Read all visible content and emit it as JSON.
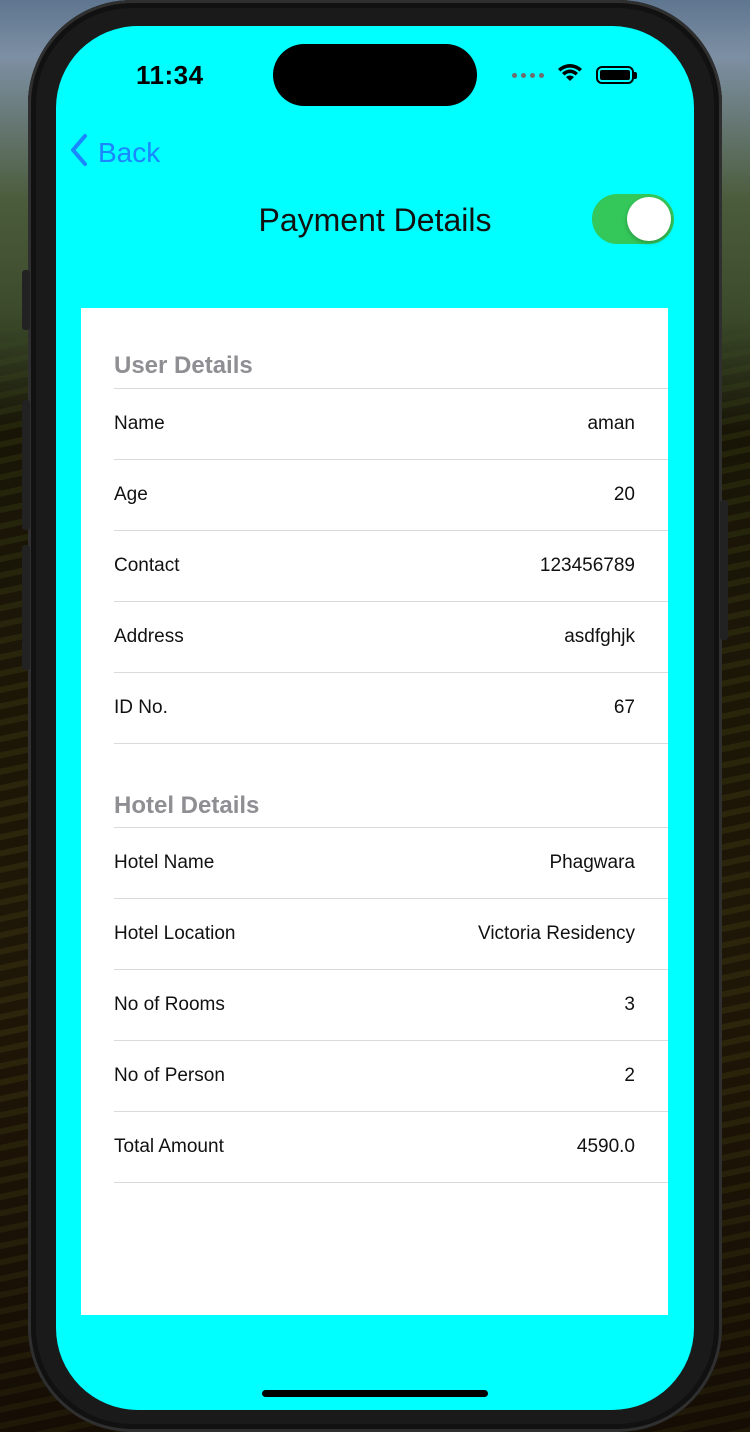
{
  "status_bar": {
    "time": "11:34"
  },
  "nav": {
    "back_label": "Back",
    "title": "Payment Details",
    "toggle_on": true
  },
  "user_details": {
    "header": "User Details",
    "rows": [
      {
        "label": "Name",
        "value": "aman"
      },
      {
        "label": "Age",
        "value": "20"
      },
      {
        "label": "Contact",
        "value": "123456789"
      },
      {
        "label": "Address",
        "value": "asdfghjk"
      },
      {
        "label": "ID No.",
        "value": "67"
      }
    ]
  },
  "hotel_details": {
    "header": "Hotel Details",
    "rows": [
      {
        "label": "Hotel Name",
        "value": "Phagwara"
      },
      {
        "label": "Hotel Location",
        "value": "Victoria Residency"
      },
      {
        "label": "No of Rooms",
        "value": "3"
      },
      {
        "label": "No of Person",
        "value": "2"
      },
      {
        "label": "Total Amount",
        "value": "4590.0"
      }
    ]
  },
  "colors": {
    "screen_background": "#00ffff",
    "accent": "#1a86ff",
    "toggle_on": "#34c759",
    "section_header": "#8e8e93"
  }
}
